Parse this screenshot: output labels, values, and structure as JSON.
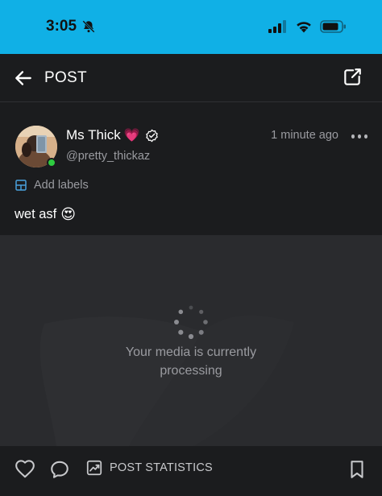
{
  "status_bar": {
    "time": "3:05",
    "icons": [
      "bell-slash-icon",
      "cellular-signal-icon",
      "wifi-icon",
      "battery-icon"
    ]
  },
  "topbar": {
    "title": "POST",
    "icons": [
      "back-arrow-icon",
      "share-icon"
    ]
  },
  "post": {
    "author_name": "Ms Thick",
    "name_emoji": "💗",
    "verified_icon": "verified-badge-icon",
    "handle": "@pretty_thickaz",
    "timestamp": "1 minute ago",
    "labels_action": "Add labels",
    "text": "wet asf",
    "text_emoji": "😍",
    "online": true
  },
  "media": {
    "processing_message": "Your media is currently processing"
  },
  "bottombar": {
    "stats_label": "POST STATISTICS",
    "icons": [
      "like-heart-icon",
      "comment-icon",
      "statistics-icon",
      "bookmark-icon"
    ]
  },
  "colors": {
    "status_bar": "#10b0e6",
    "background": "#1b1c1e",
    "media_bg": "#2a2b2e",
    "muted_text": "#9a9ba0",
    "labels_icon": "#4aa3df",
    "online": "#2ecc40"
  }
}
